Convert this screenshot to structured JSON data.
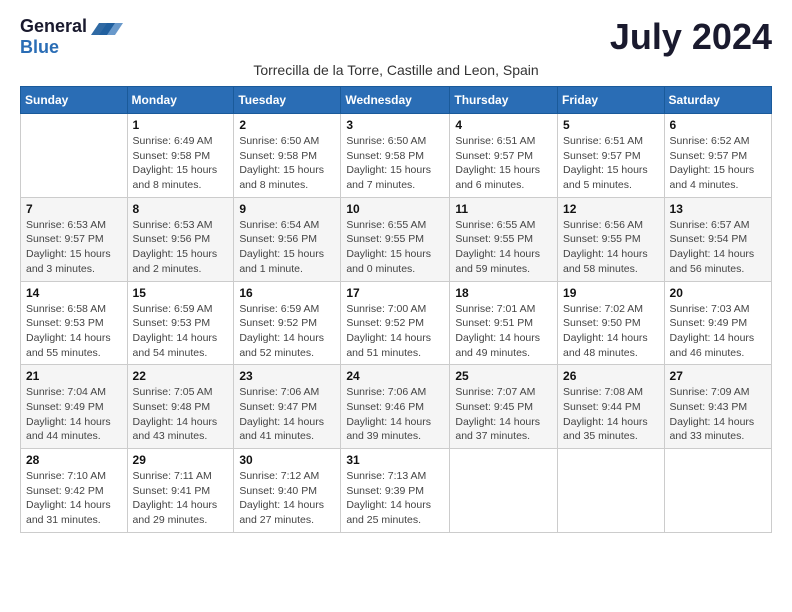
{
  "logo": {
    "general": "General",
    "blue": "Blue"
  },
  "header": {
    "month_title": "July 2024",
    "subtitle": "Torrecilla de la Torre, Castille and Leon, Spain"
  },
  "days_of_week": [
    "Sunday",
    "Monday",
    "Tuesday",
    "Wednesday",
    "Thursday",
    "Friday",
    "Saturday"
  ],
  "weeks": [
    [
      {
        "day": "",
        "sunrise": "",
        "sunset": "",
        "daylight": ""
      },
      {
        "day": "1",
        "sunrise": "Sunrise: 6:49 AM",
        "sunset": "Sunset: 9:58 PM",
        "daylight": "Daylight: 15 hours and 8 minutes."
      },
      {
        "day": "2",
        "sunrise": "Sunrise: 6:50 AM",
        "sunset": "Sunset: 9:58 PM",
        "daylight": "Daylight: 15 hours and 8 minutes."
      },
      {
        "day": "3",
        "sunrise": "Sunrise: 6:50 AM",
        "sunset": "Sunset: 9:58 PM",
        "daylight": "Daylight: 15 hours and 7 minutes."
      },
      {
        "day": "4",
        "sunrise": "Sunrise: 6:51 AM",
        "sunset": "Sunset: 9:57 PM",
        "daylight": "Daylight: 15 hours and 6 minutes."
      },
      {
        "day": "5",
        "sunrise": "Sunrise: 6:51 AM",
        "sunset": "Sunset: 9:57 PM",
        "daylight": "Daylight: 15 hours and 5 minutes."
      },
      {
        "day": "6",
        "sunrise": "Sunrise: 6:52 AM",
        "sunset": "Sunset: 9:57 PM",
        "daylight": "Daylight: 15 hours and 4 minutes."
      }
    ],
    [
      {
        "day": "7",
        "sunrise": "Sunrise: 6:53 AM",
        "sunset": "Sunset: 9:57 PM",
        "daylight": "Daylight: 15 hours and 3 minutes."
      },
      {
        "day": "8",
        "sunrise": "Sunrise: 6:53 AM",
        "sunset": "Sunset: 9:56 PM",
        "daylight": "Daylight: 15 hours and 2 minutes."
      },
      {
        "day": "9",
        "sunrise": "Sunrise: 6:54 AM",
        "sunset": "Sunset: 9:56 PM",
        "daylight": "Daylight: 15 hours and 1 minute."
      },
      {
        "day": "10",
        "sunrise": "Sunrise: 6:55 AM",
        "sunset": "Sunset: 9:55 PM",
        "daylight": "Daylight: 15 hours and 0 minutes."
      },
      {
        "day": "11",
        "sunrise": "Sunrise: 6:55 AM",
        "sunset": "Sunset: 9:55 PM",
        "daylight": "Daylight: 14 hours and 59 minutes."
      },
      {
        "day": "12",
        "sunrise": "Sunrise: 6:56 AM",
        "sunset": "Sunset: 9:55 PM",
        "daylight": "Daylight: 14 hours and 58 minutes."
      },
      {
        "day": "13",
        "sunrise": "Sunrise: 6:57 AM",
        "sunset": "Sunset: 9:54 PM",
        "daylight": "Daylight: 14 hours and 56 minutes."
      }
    ],
    [
      {
        "day": "14",
        "sunrise": "Sunrise: 6:58 AM",
        "sunset": "Sunset: 9:53 PM",
        "daylight": "Daylight: 14 hours and 55 minutes."
      },
      {
        "day": "15",
        "sunrise": "Sunrise: 6:59 AM",
        "sunset": "Sunset: 9:53 PM",
        "daylight": "Daylight: 14 hours and 54 minutes."
      },
      {
        "day": "16",
        "sunrise": "Sunrise: 6:59 AM",
        "sunset": "Sunset: 9:52 PM",
        "daylight": "Daylight: 14 hours and 52 minutes."
      },
      {
        "day": "17",
        "sunrise": "Sunrise: 7:00 AM",
        "sunset": "Sunset: 9:52 PM",
        "daylight": "Daylight: 14 hours and 51 minutes."
      },
      {
        "day": "18",
        "sunrise": "Sunrise: 7:01 AM",
        "sunset": "Sunset: 9:51 PM",
        "daylight": "Daylight: 14 hours and 49 minutes."
      },
      {
        "day": "19",
        "sunrise": "Sunrise: 7:02 AM",
        "sunset": "Sunset: 9:50 PM",
        "daylight": "Daylight: 14 hours and 48 minutes."
      },
      {
        "day": "20",
        "sunrise": "Sunrise: 7:03 AM",
        "sunset": "Sunset: 9:49 PM",
        "daylight": "Daylight: 14 hours and 46 minutes."
      }
    ],
    [
      {
        "day": "21",
        "sunrise": "Sunrise: 7:04 AM",
        "sunset": "Sunset: 9:49 PM",
        "daylight": "Daylight: 14 hours and 44 minutes."
      },
      {
        "day": "22",
        "sunrise": "Sunrise: 7:05 AM",
        "sunset": "Sunset: 9:48 PM",
        "daylight": "Daylight: 14 hours and 43 minutes."
      },
      {
        "day": "23",
        "sunrise": "Sunrise: 7:06 AM",
        "sunset": "Sunset: 9:47 PM",
        "daylight": "Daylight: 14 hours and 41 minutes."
      },
      {
        "day": "24",
        "sunrise": "Sunrise: 7:06 AM",
        "sunset": "Sunset: 9:46 PM",
        "daylight": "Daylight: 14 hours and 39 minutes."
      },
      {
        "day": "25",
        "sunrise": "Sunrise: 7:07 AM",
        "sunset": "Sunset: 9:45 PM",
        "daylight": "Daylight: 14 hours and 37 minutes."
      },
      {
        "day": "26",
        "sunrise": "Sunrise: 7:08 AM",
        "sunset": "Sunset: 9:44 PM",
        "daylight": "Daylight: 14 hours and 35 minutes."
      },
      {
        "day": "27",
        "sunrise": "Sunrise: 7:09 AM",
        "sunset": "Sunset: 9:43 PM",
        "daylight": "Daylight: 14 hours and 33 minutes."
      }
    ],
    [
      {
        "day": "28",
        "sunrise": "Sunrise: 7:10 AM",
        "sunset": "Sunset: 9:42 PM",
        "daylight": "Daylight: 14 hours and 31 minutes."
      },
      {
        "day": "29",
        "sunrise": "Sunrise: 7:11 AM",
        "sunset": "Sunset: 9:41 PM",
        "daylight": "Daylight: 14 hours and 29 minutes."
      },
      {
        "day": "30",
        "sunrise": "Sunrise: 7:12 AM",
        "sunset": "Sunset: 9:40 PM",
        "daylight": "Daylight: 14 hours and 27 minutes."
      },
      {
        "day": "31",
        "sunrise": "Sunrise: 7:13 AM",
        "sunset": "Sunset: 9:39 PM",
        "daylight": "Daylight: 14 hours and 25 minutes."
      },
      {
        "day": "",
        "sunrise": "",
        "sunset": "",
        "daylight": ""
      },
      {
        "day": "",
        "sunrise": "",
        "sunset": "",
        "daylight": ""
      },
      {
        "day": "",
        "sunrise": "",
        "sunset": "",
        "daylight": ""
      }
    ]
  ]
}
